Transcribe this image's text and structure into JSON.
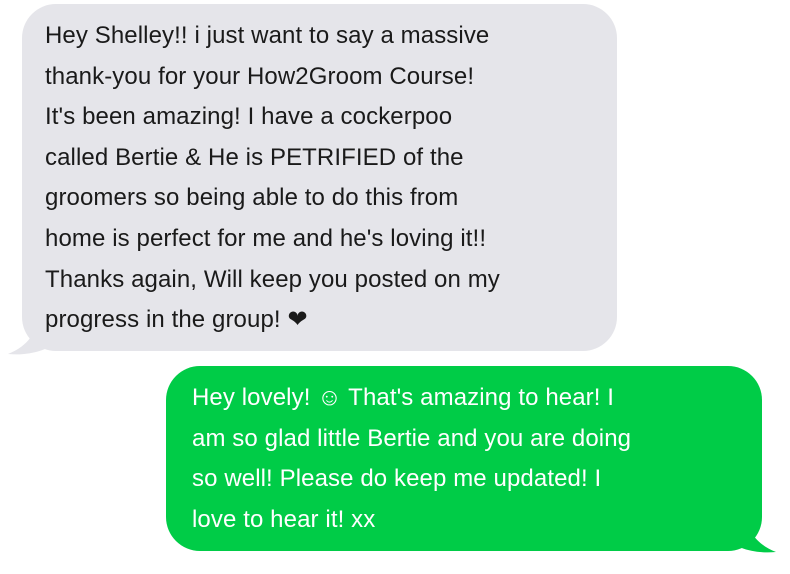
{
  "messages": [
    {
      "direction": "incoming",
      "bubble_color": "#e5e5ea",
      "text_color": "#1a1a1a",
      "lines": [
        "Hey Shelley!! i just want to say a massive",
        "thank-you for your How2Groom Course!",
        "It's been amazing! I have a cockerpoo",
        "called Bertie & He is PETRIFIED of the",
        "groomers so being able to do this from",
        "home is perfect for me and he's loving it!!",
        "Thanks again, Will keep you posted on my",
        "progress in the group! ❤"
      ]
    },
    {
      "direction": "outgoing",
      "bubble_color": "#00cc47",
      "text_color": "#ffffff",
      "lines": [
        "Hey lovely! ☺  That's amazing to hear! I",
        "am so glad little Bertie and you are doing",
        "so well! Please do keep me updated! I",
        "love to hear it! xx"
      ]
    }
  ]
}
